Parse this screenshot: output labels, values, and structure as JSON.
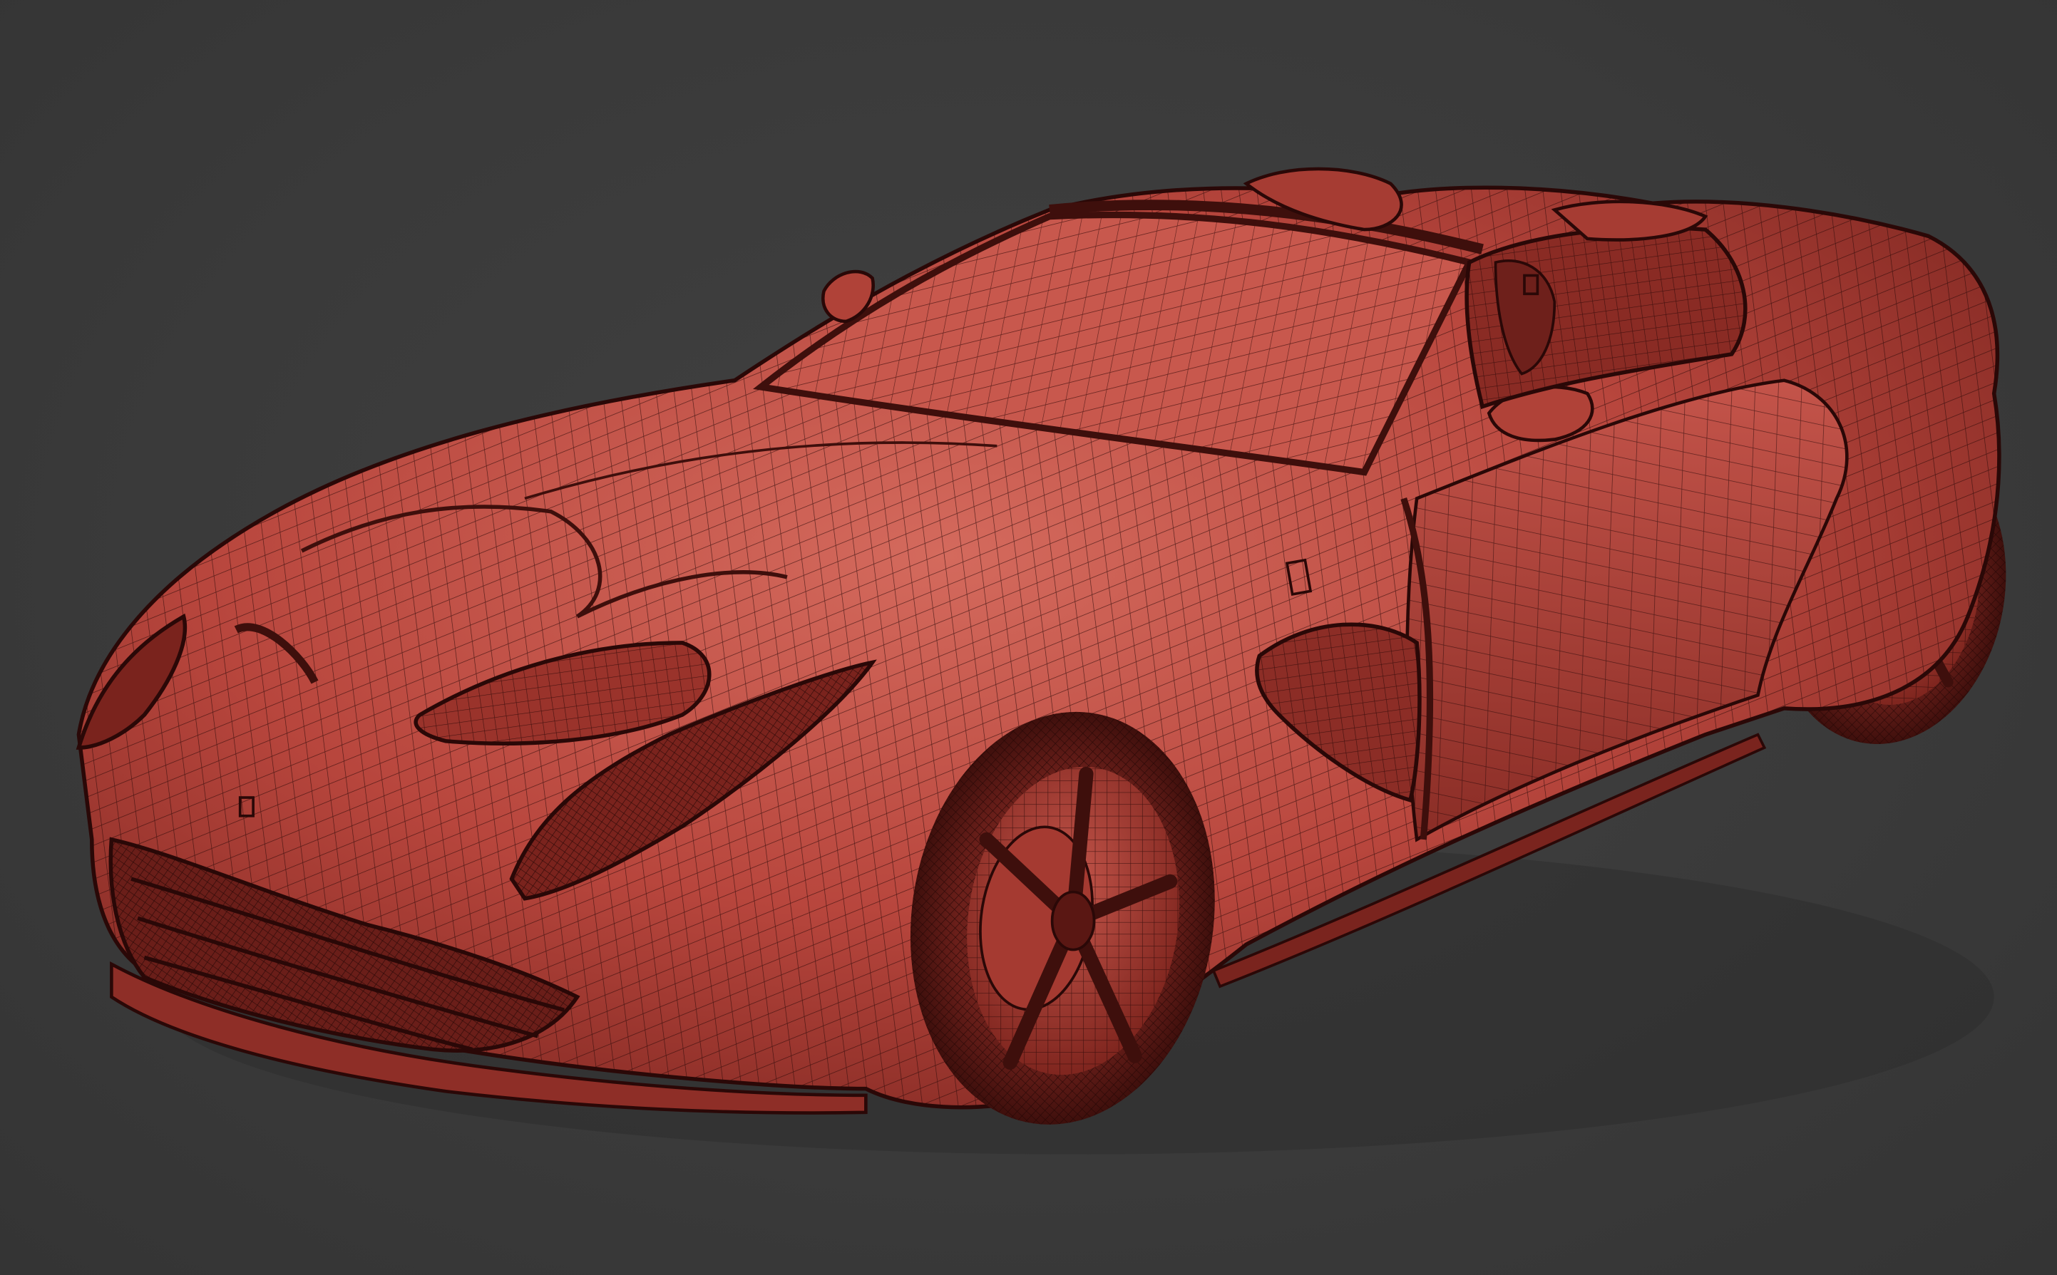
{
  "viewport": {
    "background_color": "#3b3b3b",
    "model_base_color": "#b8463d",
    "model_light_color": "#d0665a",
    "model_shadow_color": "#5e1a17",
    "wireframe_color": "#2a0807"
  },
  "model": {
    "render_mode": "wireframe-on-shaded"
  }
}
